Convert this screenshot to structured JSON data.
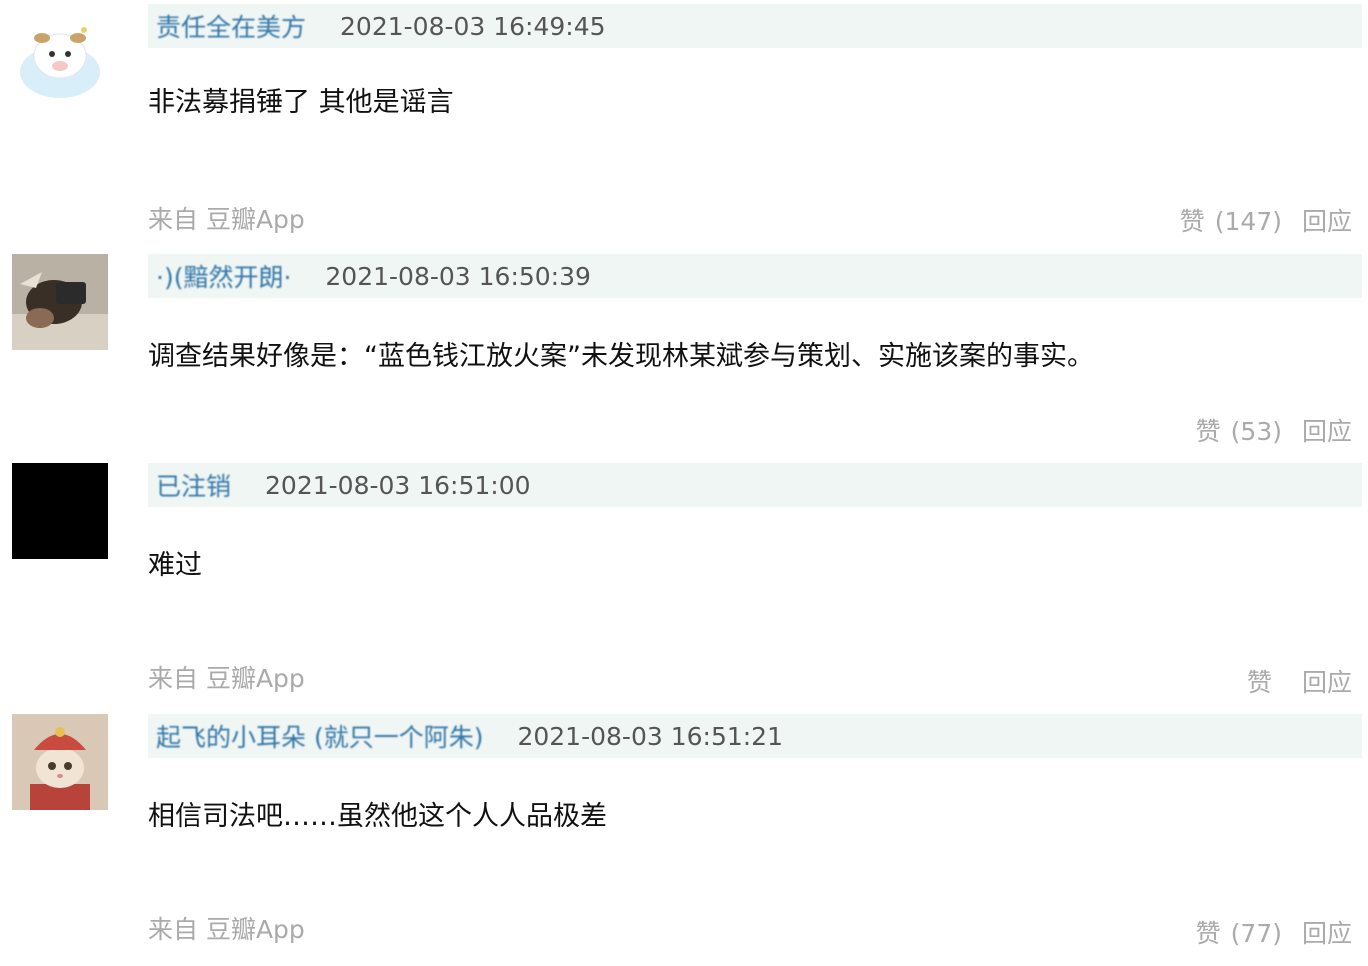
{
  "comments": [
    {
      "author": "责任全在美方",
      "time": "2021-08-03 16:49:45",
      "text": "非法募捐锤了 其他是谣言",
      "from": "来自 豆瓣App",
      "like_label": "赞",
      "like_count": "(147)",
      "reply_label": "回应",
      "avatar_icon": "cartoon-cloud-cow-avatar"
    },
    {
      "author": "·)(黯然开朗·",
      "time": "2021-08-03 16:50:39",
      "text": "调查结果好像是：“蓝色钱江放火案”未发现林某斌参与策划、实施该案的事实。",
      "from": "",
      "like_label": "赞",
      "like_count": "(53)",
      "reply_label": "回应",
      "avatar_icon": "person-photo-avatar"
    },
    {
      "author": "已注销",
      "time": "2021-08-03 16:51:00",
      "text": "难过",
      "from": "来自 豆瓣App",
      "like_label": "赞",
      "like_count": "",
      "reply_label": "回应",
      "avatar_icon": "black-avatar"
    },
    {
      "author": "起飞的小耳朵 (就只一个阿朱)",
      "time": "2021-08-03 16:51:21",
      "text": "相信司法吧……虽然他这个人人品极差",
      "from": "来自 豆瓣App",
      "like_label": "赞",
      "like_count": "(77)",
      "reply_label": "回应",
      "avatar_icon": "cat-in-costume-avatar"
    }
  ],
  "colors": {
    "meta_bar": "#f0f6f3",
    "author_link": "#3377aa",
    "muted": "#aaaaaa"
  }
}
